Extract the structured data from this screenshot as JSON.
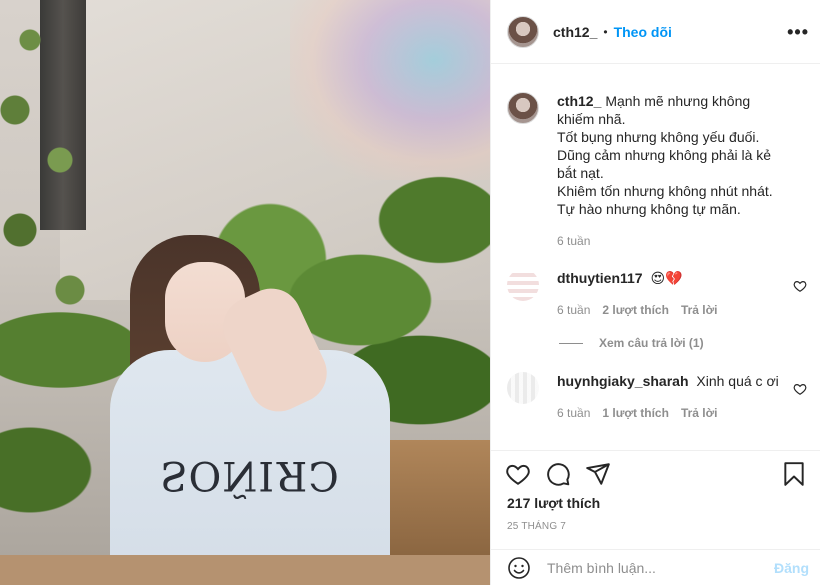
{
  "post": {
    "username": "cth12_",
    "follow_label": "Theo dõi",
    "dot": "•",
    "more_label": "•••"
  },
  "caption": {
    "username": "cth12_",
    "text": "Mạnh mẽ nhưng không khiếm nhã.\nTốt bụng nhưng không yếu đuối.\nDũng cảm nhưng không phải là kẻ bắt nạt.\nKhiêm tốn nhưng không nhút nhát.\nTự hào nhưng không tự mãn.",
    "time": "6 tuần"
  },
  "comments": [
    {
      "username": "dthuytien117",
      "text": "😍💔",
      "time": "6 tuần",
      "likes": "2 lượt thích",
      "reply_label": "Trả lời",
      "view_replies": "Xem câu trả lời (1)"
    },
    {
      "username": "huynhgiaky_sharah",
      "text": "Xinh quá c ơi",
      "time": "6 tuần",
      "likes": "1 lượt thích",
      "reply_label": "Trả lời"
    }
  ],
  "stats": {
    "likes": "217 lượt thích",
    "date": "25 THÁNG 7"
  },
  "comment_input": {
    "placeholder": "Thêm bình luận...",
    "post_label": "Đăng"
  },
  "photo": {
    "shirt_text": "SOÑIЯƆ"
  }
}
